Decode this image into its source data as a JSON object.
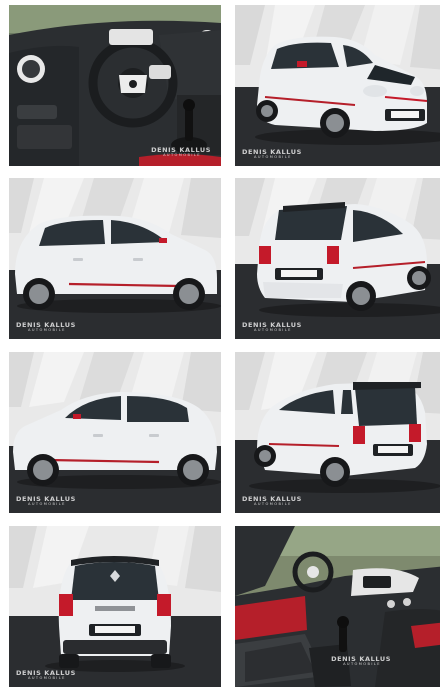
{
  "gallery": {
    "watermark": {
      "brand": "DENIS KALLUS",
      "sub": "AUTOMOBILE"
    },
    "photos": [
      {
        "view": "interior-dashboard"
      },
      {
        "view": "front-three-quarter",
        "plate": "DENIS KALLUS"
      },
      {
        "view": "side-profile"
      },
      {
        "view": "rear-three-quarter",
        "plate": "DENIS KALLUS"
      },
      {
        "view": "side-profile-left"
      },
      {
        "view": "rear-three-quarter-left",
        "plate": "DENIS KALLUS"
      },
      {
        "view": "rear",
        "plate": "DENIS KALLUS",
        "badge": "TWINGO"
      },
      {
        "view": "interior-seats"
      }
    ]
  },
  "colors": {
    "car_body": "#eef0f2",
    "accent_red": "#c41a2a",
    "showroom_wall": "#e9e9e9",
    "showroom_floor": "#2b2d30",
    "dashboard": "#2b2e31"
  }
}
